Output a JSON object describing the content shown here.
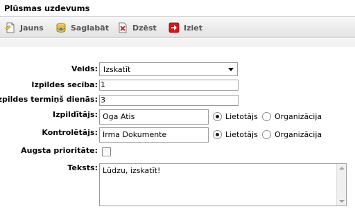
{
  "window": {
    "title": "Plūsmas uzdevums"
  },
  "toolbar": {
    "new_label": "Jauns",
    "save_label": "Saglabāt",
    "delete_label": "Dzēst",
    "exit_label": "Iziet"
  },
  "form": {
    "type": {
      "label": "Veids:",
      "value": "Izskatīt"
    },
    "order": {
      "label": "Izpildes secība:",
      "value": "1"
    },
    "term": {
      "label": "Izpildes termiņš dienās:",
      "value": "3"
    },
    "executor": {
      "label": "Izpildītājs:",
      "value": "Oga Atis",
      "radio_user": "Lietotājs",
      "radio_org": "Organizācija",
      "selected": "Lietotājs"
    },
    "controller": {
      "label": "Kontrolētājs:",
      "value": "Irma Dokumente",
      "radio_user": "Lietotājs",
      "radio_org": "Organizācija",
      "selected": "Lietotājs"
    },
    "priority": {
      "label": "Augsta prioritāte:",
      "checked": false
    },
    "text": {
      "label": "Teksts:",
      "value": "Lūdzu, izskatīt!"
    }
  }
}
